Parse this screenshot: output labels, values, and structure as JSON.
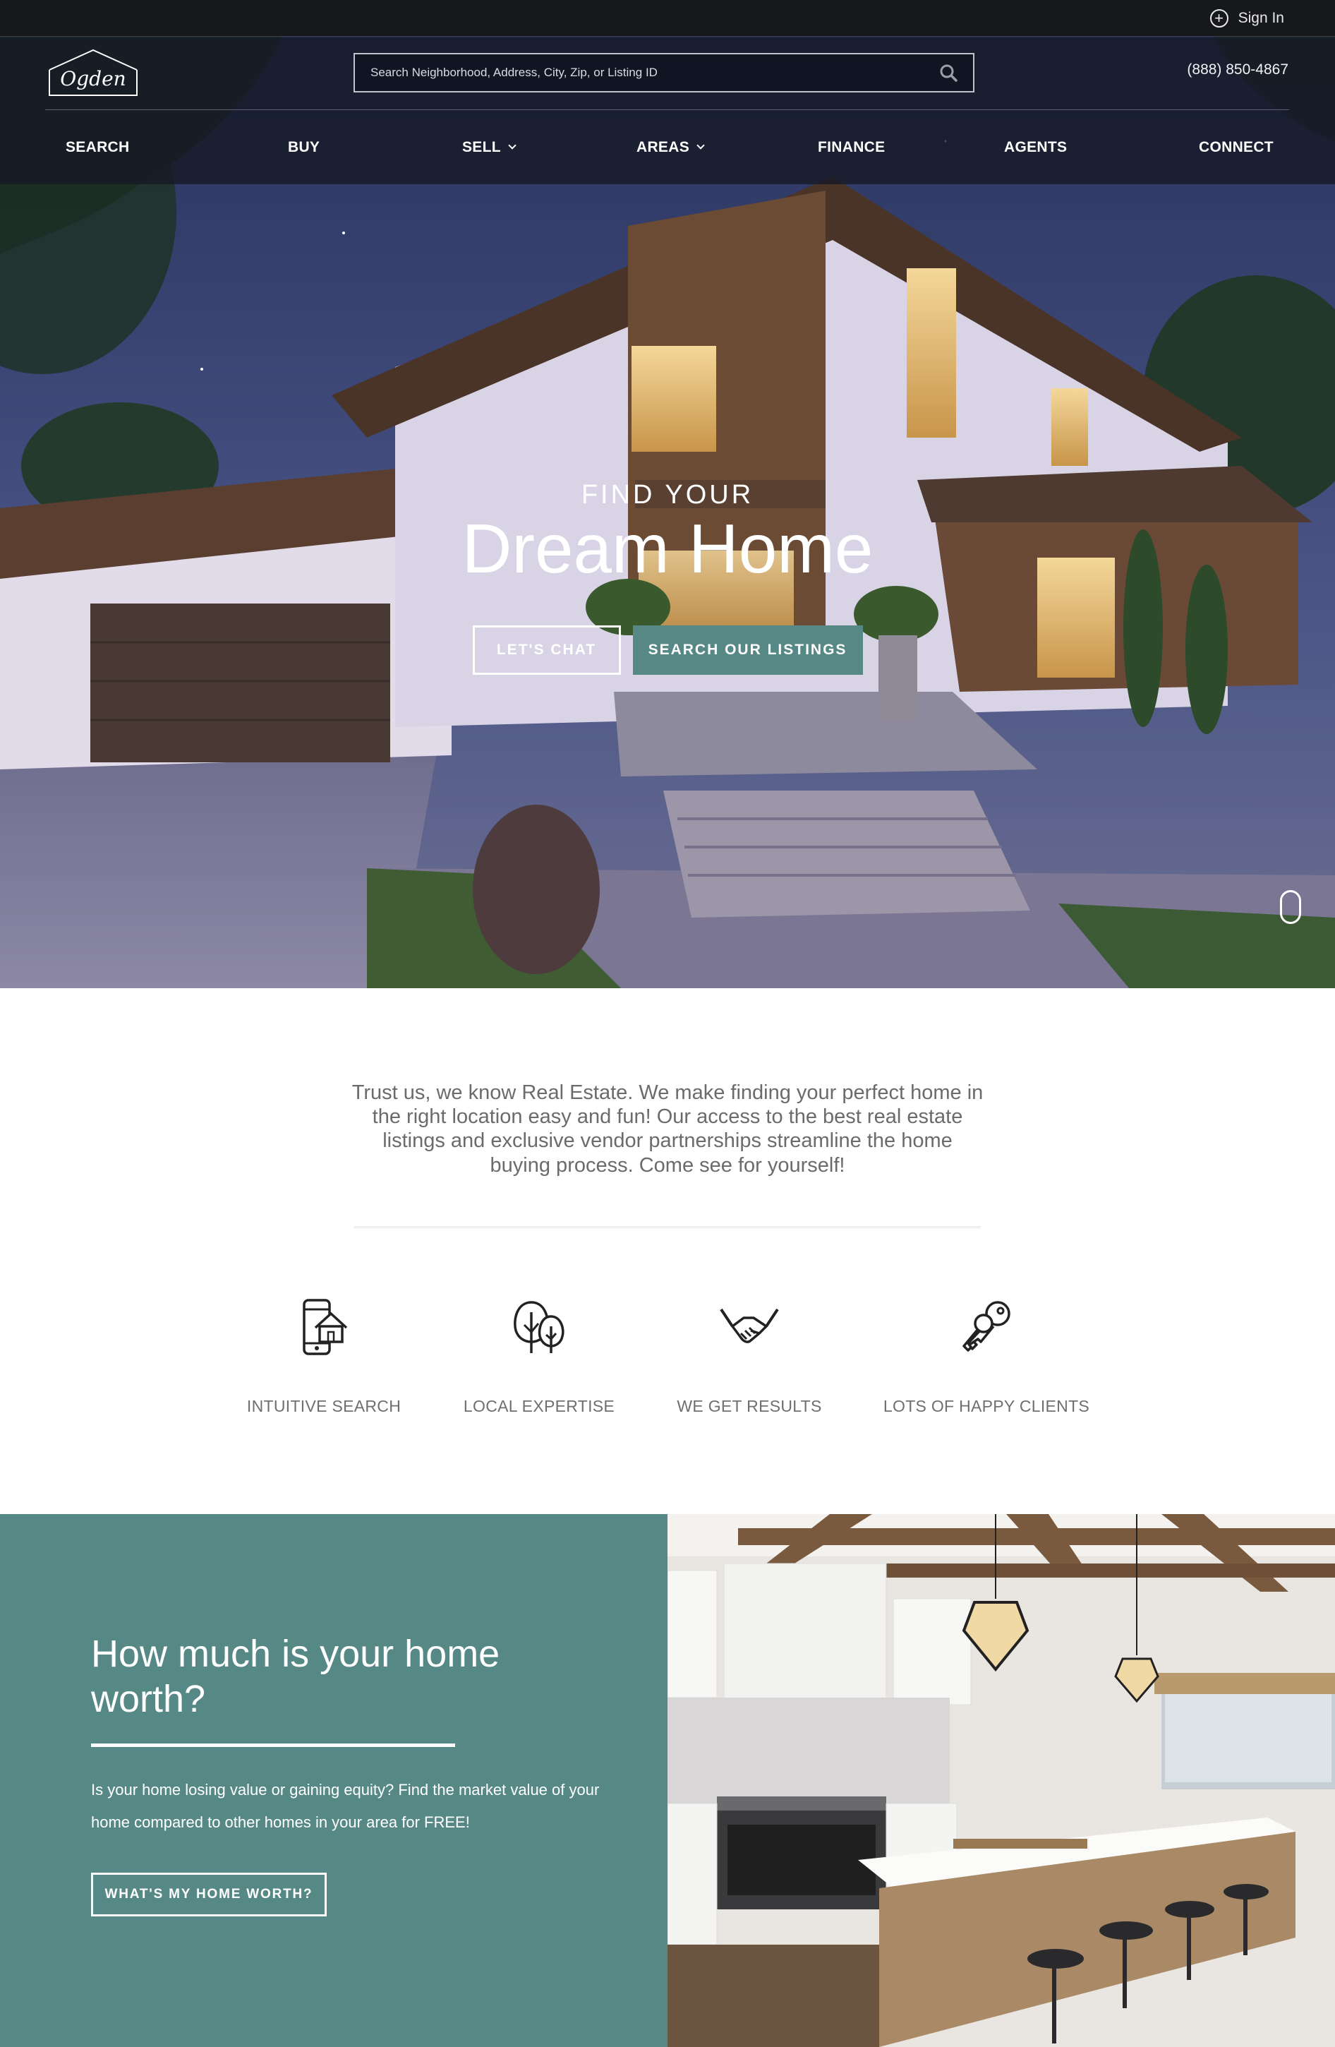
{
  "topbar": {
    "signin_label": "Sign In",
    "signin_icon": "plus-circle-icon"
  },
  "header": {
    "logo_text": "Ogden",
    "search_placeholder": "Search Neighborhood, Address, City, Zip, or Listing ID",
    "search_icon": "search-icon",
    "phone": "(888) 850-4867"
  },
  "nav": {
    "items": [
      {
        "label": "SEARCH",
        "dropdown": false
      },
      {
        "label": "BUY",
        "dropdown": false
      },
      {
        "label": "SELL",
        "dropdown": true
      },
      {
        "label": "AREAS",
        "dropdown": true
      },
      {
        "label": "FINANCE",
        "dropdown": false
      },
      {
        "label": "AGENTS",
        "dropdown": false
      },
      {
        "label": "CONNECT",
        "dropdown": false
      }
    ]
  },
  "hero": {
    "kicker": "FIND YOUR",
    "title": "Dream Home",
    "chat_button": "LET'S CHAT",
    "listings_button": "SEARCH OUR LISTINGS"
  },
  "intro": {
    "text": "Trust us, we know Real Estate. We make finding your perfect home in the right location easy and fun! Our access to the best real estate listings and exclusive vendor partnerships streamline the home buying process. Come see for yourself!"
  },
  "features": [
    {
      "label": "INTUITIVE SEARCH",
      "icon": "phone-house-icon"
    },
    {
      "label": "LOCAL EXPERTISE",
      "icon": "trees-icon"
    },
    {
      "label": "WE GET RESULTS",
      "icon": "handshake-icon"
    },
    {
      "label": "LOTS OF HAPPY CLIENTS",
      "icon": "keys-icon"
    }
  ],
  "worth": {
    "title": "How much is your home worth?",
    "body": "Is your home losing value or gaining equity? Find the market value of your home compared to other homes in your area for FREE!",
    "button": "WHAT'S MY HOME WORTH?"
  },
  "colors": {
    "accent": "#568986",
    "topbar": "#16181c",
    "text_gray": "#6b6b6b"
  }
}
